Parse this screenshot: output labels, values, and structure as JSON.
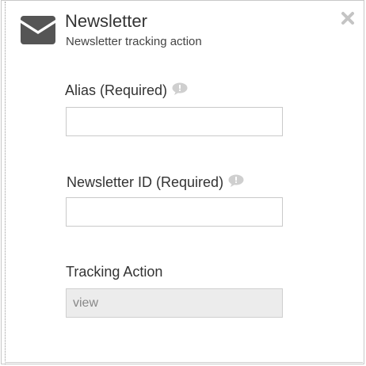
{
  "header": {
    "title": "Newsletter",
    "subtitle": "Newsletter tracking action",
    "icon": "envelope-icon",
    "close_icon": "close-icon"
  },
  "fields": {
    "alias": {
      "label": "Alias (Required)",
      "value": "",
      "help_icon": "comment-bubble-icon"
    },
    "newsletter_id": {
      "label": "Newsletter ID (Required)",
      "value": "",
      "help_icon": "comment-bubble-icon"
    },
    "tracking_action": {
      "label": "Tracking Action",
      "value": "view"
    }
  },
  "colors": {
    "text": "#333333",
    "input_border": "#c9c9c9",
    "readonly_bg": "#ececec",
    "help_icon": "#c8c8c8",
    "icon": "#555555"
  }
}
